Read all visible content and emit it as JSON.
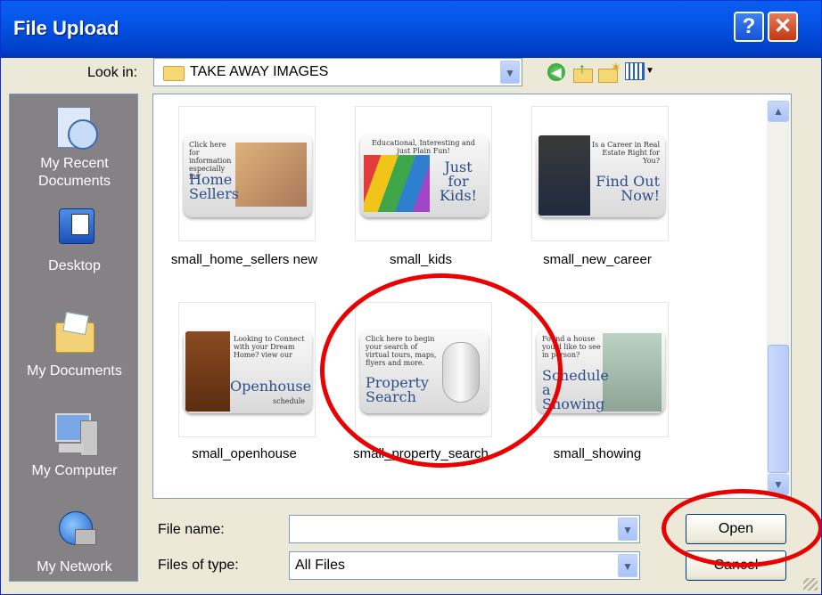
{
  "window": {
    "title": "File Upload",
    "help_glyph": "?",
    "close_glyph": "✕"
  },
  "lookin": {
    "label": "Look in:",
    "value": "TAKE AWAY IMAGES",
    "toolbar_icons": [
      "back-icon",
      "up-folder-icon",
      "new-folder-icon",
      "view-menu-icon"
    ]
  },
  "places": [
    {
      "label": "My Recent\nDocuments",
      "icon": "recent-documents-icon"
    },
    {
      "label": "Desktop",
      "icon": "desktop-icon"
    },
    {
      "label": "My Documents",
      "icon": "my-documents-icon"
    },
    {
      "label": "My Computer",
      "icon": "my-computer-icon"
    },
    {
      "label": "My Network",
      "icon": "my-network-icon"
    }
  ],
  "files": [
    {
      "name": "small_home_sellers new",
      "card": {
        "small": "Click here for information especially for",
        "big": "Home Sellers"
      }
    },
    {
      "name": "small_kids",
      "card": {
        "small": "Educational, Interesting and just Plain Fun!",
        "big": "Just for Kids!"
      }
    },
    {
      "name": "small_new_career",
      "card": {
        "small": "Is a Career in Real Estate Right for You?",
        "big": "Find Out Now!"
      }
    },
    {
      "name": "small_openhouse",
      "card": {
        "small": "Looking to Connect with your Dream Home? view our",
        "big": "Openhouse",
        "extra": "schedule"
      }
    },
    {
      "name": "small_property_search",
      "card": {
        "small": "Click here to begin your search of virtual tours, maps, flyers and more.",
        "big": "Property Search"
      }
    },
    {
      "name": "small_showing",
      "card": {
        "small": "Found a house you'd like to see in person?",
        "big": "Schedule a Showing"
      }
    }
  ],
  "filename": {
    "label": "File name:",
    "value": ""
  },
  "filetype": {
    "label": "Files of type:",
    "value": "All Files"
  },
  "buttons": {
    "open": "Open",
    "cancel": "Cancel"
  },
  "annotation_color": "#ea0000"
}
